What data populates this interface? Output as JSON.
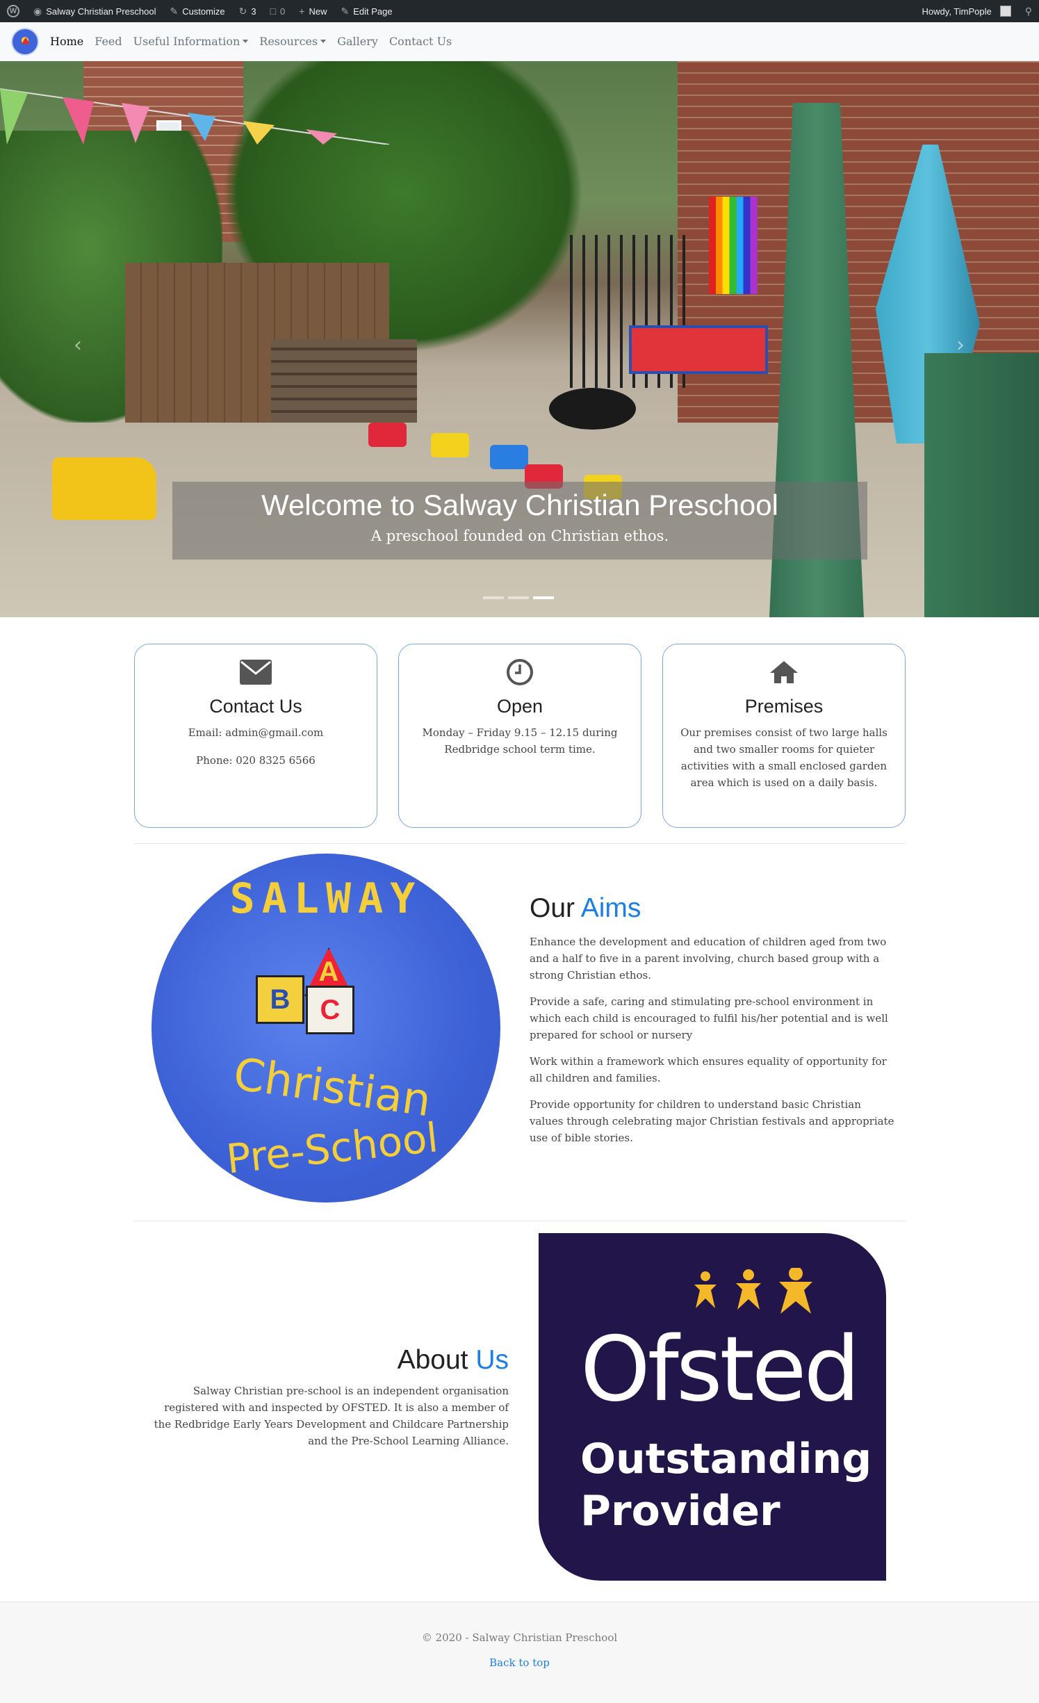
{
  "admin_bar": {
    "site_name": "Salway Christian Preschool",
    "customize": "Customize",
    "updates_count": "3",
    "comments_count": "0",
    "new": "New",
    "edit_page": "Edit Page",
    "howdy": "Howdy, TimPople"
  },
  "nav": {
    "items": [
      {
        "label": "Home",
        "active": true
      },
      {
        "label": "Feed"
      },
      {
        "label": "Useful Information",
        "dropdown": true
      },
      {
        "label": "Resources",
        "dropdown": true
      },
      {
        "label": "Gallery"
      },
      {
        "label": "Contact Us"
      }
    ]
  },
  "hero": {
    "title": "Welcome to Salway Christian Preschool",
    "subtitle": "A preschool founded on Christian ethos.",
    "slide_count": 3,
    "active_slide": 3
  },
  "cards": [
    {
      "icon": "envelope-icon",
      "title": "Contact Us",
      "lines": [
        "Email: admin@gmail.com",
        "Phone: 020 8325 6566"
      ]
    },
    {
      "icon": "clock-icon",
      "title": "Open",
      "lines": [
        "Monday – Friday 9.15 – 12.15 during Redbridge school term time."
      ]
    },
    {
      "icon": "home-icon",
      "title": "Premises",
      "lines": [
        "Our premises consist of two large halls and two smaller rooms for quieter activities with a small enclosed garden area which is used on a daily basis."
      ]
    }
  ],
  "aims": {
    "title_a": "Our",
    "title_b": "Aims",
    "logo_text": {
      "top": "SALWAY",
      "middle": "Christian",
      "bottom": "Pre-School",
      "blocks": [
        "A",
        "B",
        "C"
      ]
    },
    "paragraphs": [
      "Enhance the development and education of children aged from two and a half to five in a parent involving, church based group with a strong Christian ethos.",
      "Provide a safe, caring and stimulating pre-school environment in which each child is encouraged to fulfil his/her potential and is well prepared for school or nursery",
      "Work within a framework which ensures equality of opportunity for all children and families.",
      "Provide opportunity for children to understand basic Christian values through celebrating major Christian festivals and appropriate use of bible stories."
    ]
  },
  "about": {
    "title_a": "About",
    "title_b": "Us",
    "text": "Salway Christian pre-school is an independent organisation registered with and inspected by OFSTED. It is also a member of the Redbridge Early Years Development and Childcare Partnership and the Pre-School Learning Alliance.",
    "badge": {
      "word": "Ofsted",
      "line1": "Outstanding",
      "line2": "Provider"
    }
  },
  "footer": {
    "copyright": "© 2020 - Salway Christian Preschool",
    "back_to_top": "Back to top"
  },
  "colors": {
    "accent": "#1a7fe6",
    "card_border": "#7aa6e6",
    "ofsted_bg": "#221549",
    "admin_bar": "#23282d"
  }
}
